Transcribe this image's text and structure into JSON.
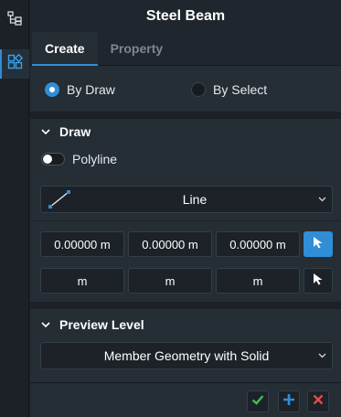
{
  "panel": {
    "title": "Steel Beam"
  },
  "sidebar": {
    "items": [
      {
        "icon": "tree-hierarchy-icon",
        "active": false
      },
      {
        "icon": "component-grid-icon",
        "active": true
      }
    ]
  },
  "tabs": [
    {
      "label": "Create",
      "active": true
    },
    {
      "label": "Property",
      "active": false
    }
  ],
  "mode": {
    "options": [
      {
        "label": "By Draw",
        "selected": true
      },
      {
        "label": "By Select",
        "selected": false
      }
    ]
  },
  "draw": {
    "header": "Draw",
    "polyline_label": "Polyline",
    "polyline_on": false,
    "shape_select": {
      "icon": "line-shape-icon",
      "value": "Line"
    },
    "point_row_1": [
      "0.00000 m",
      "0.00000 m",
      "0.00000 m"
    ],
    "point_row_2": [
      "m",
      "m",
      "m"
    ]
  },
  "preview": {
    "header": "Preview Level",
    "value": "Member Geometry with Solid"
  },
  "colors": {
    "accent": "#2f8ed6",
    "ok": "#3fbf5a",
    "add": "#2f8ed6",
    "cancel": "#e24b4b"
  }
}
